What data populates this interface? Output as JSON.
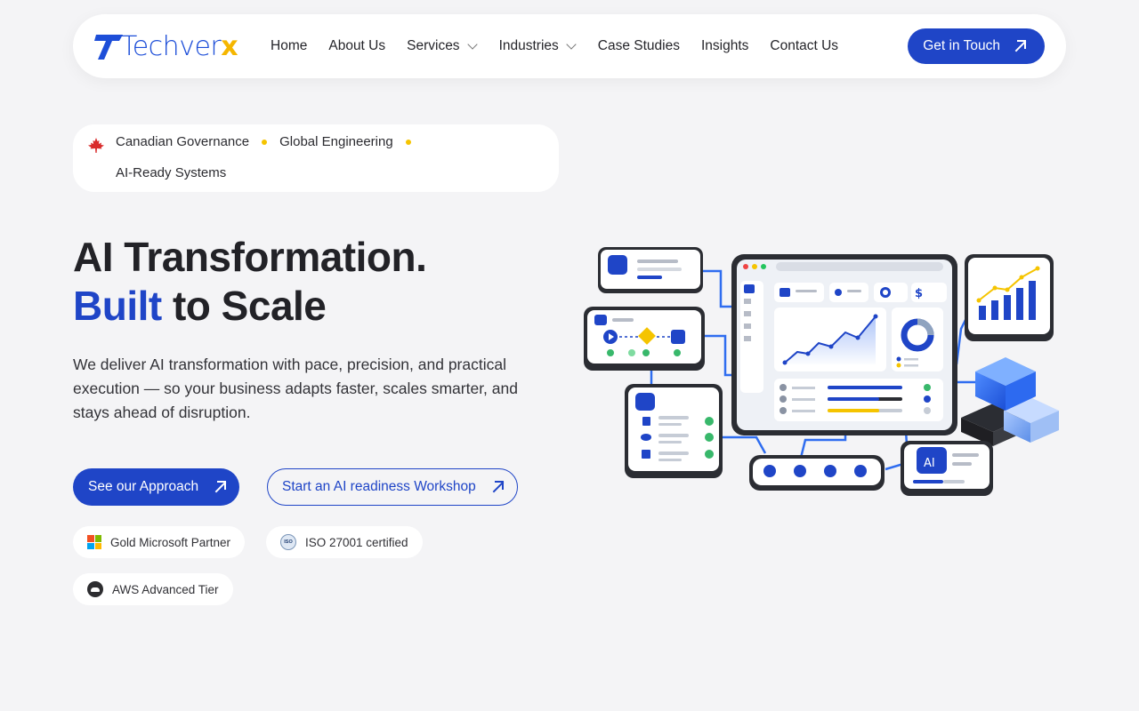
{
  "brand": {
    "logo_main": "Techver",
    "logo_accent": "x",
    "accent_color": "#1f45c7",
    "highlight_color": "#f5c400"
  },
  "nav": {
    "links": [
      {
        "label": "Home",
        "has_dropdown": false
      },
      {
        "label": "About Us",
        "has_dropdown": false
      },
      {
        "label": "Services",
        "has_dropdown": true
      },
      {
        "label": "Industries",
        "has_dropdown": true
      },
      {
        "label": "Case Studies",
        "has_dropdown": false
      },
      {
        "label": "Insights",
        "has_dropdown": false
      },
      {
        "label": "Contact Us",
        "has_dropdown": false
      }
    ],
    "cta_label": "Get in Touch"
  },
  "badges": {
    "item1": "Canadian Governance",
    "item2": "Global Engineering",
    "item3": "AI-Ready Systems",
    "icon": "maple-leaf-icon"
  },
  "hero": {
    "title_line1": "AI Transformation.",
    "title_highlight": "Built",
    "title_rest": "to Scale",
    "lead": "We deliver AI transformation with pace, precision, and practical execution — so your business adapts faster, scales smarter, and stays ahead of disruption.",
    "primary_button": "See our Approach",
    "secondary_button": "Start an AI readiness Workshop"
  },
  "certifications": [
    {
      "label": "Gold Microsoft Partner",
      "icon": "microsoft-icon"
    },
    {
      "label": "ISO 27001 certified",
      "icon": "iso-icon",
      "icon_text": "ISO"
    },
    {
      "label": "AWS Advanced Tier",
      "icon": "aws-icon"
    }
  ],
  "illustration": {
    "chip_text": "AI"
  }
}
